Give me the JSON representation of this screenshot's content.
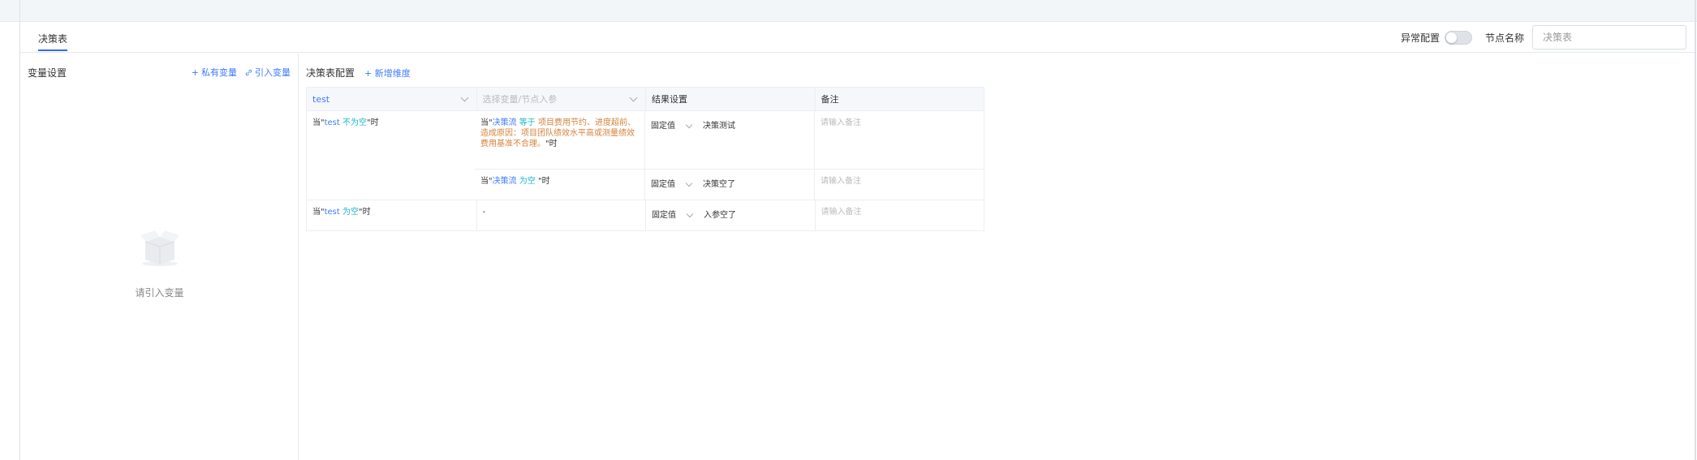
{
  "header": {
    "tab": "决策表",
    "anomaly_label": "异常配置",
    "anomaly_enabled": false,
    "node_name_label": "节点名称",
    "node_name_placeholder": "决策表"
  },
  "sidebar": {
    "title": "变量设置",
    "private_var": "私有变量",
    "import_var": "引入变量",
    "empty_text": "请引入变量"
  },
  "main": {
    "title": "决策表配置",
    "add_dimension": "新增维度",
    "columns": {
      "c1": "test",
      "c2": "选择变量/节点入参",
      "c3": "结果设置",
      "c4": "备注"
    },
    "rows": [
      {
        "cond1": {
          "pre": "当\"",
          "var": "test",
          "op": "不为空",
          "post": "\"时"
        },
        "subs": [
          {
            "cond2": {
              "pre": "当\"",
              "var": "决策流",
              "op": "等于",
              "value": "项目费用节约、进度超前、造成原因：项目团队绩效水平高或测量绩效费用基准不合理。",
              "post": "\"时"
            },
            "result_type": "固定值",
            "result_value": "决策测试",
            "remark_placeholder": "请输入备注"
          },
          {
            "cond2": {
              "pre": "当\"",
              "var": "决策流",
              "op": "为空",
              "value": "",
              "post": "\"时"
            },
            "result_type": "固定值",
            "result_value": "决策空了",
            "remark_placeholder": "请输入备注"
          }
        ]
      },
      {
        "cond1": {
          "pre": "当\"",
          "var": "test",
          "op": "为空",
          "post": "\"时"
        },
        "subs": [
          {
            "cond2_dash": "-",
            "result_type": "固定值",
            "result_value": "入参空了",
            "remark_placeholder": "请输入备注"
          }
        ]
      }
    ]
  },
  "colors": {
    "accent": "#3d7bff",
    "operator": "#1ab6c8",
    "value": "#d5823a"
  }
}
